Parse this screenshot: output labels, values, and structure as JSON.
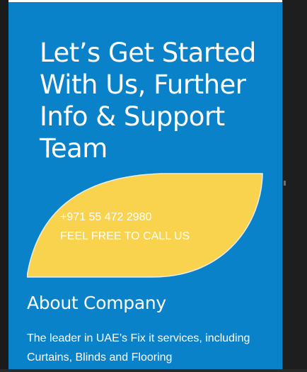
{
  "hero": {
    "headline": "Let’s Get Started With Us, Further Info & Support Team"
  },
  "cta": {
    "phone": "+971 55 472 2980",
    "call_text": "FEEL FREE TO CALL US"
  },
  "about": {
    "title": "About Company",
    "text": "The leader in UAE’s Fix it services, including Curtains, Blinds and Flooring"
  },
  "colors": {
    "panel_bg": "#0a82c9",
    "leaf": "#fad34e",
    "text": "#ffffff"
  }
}
